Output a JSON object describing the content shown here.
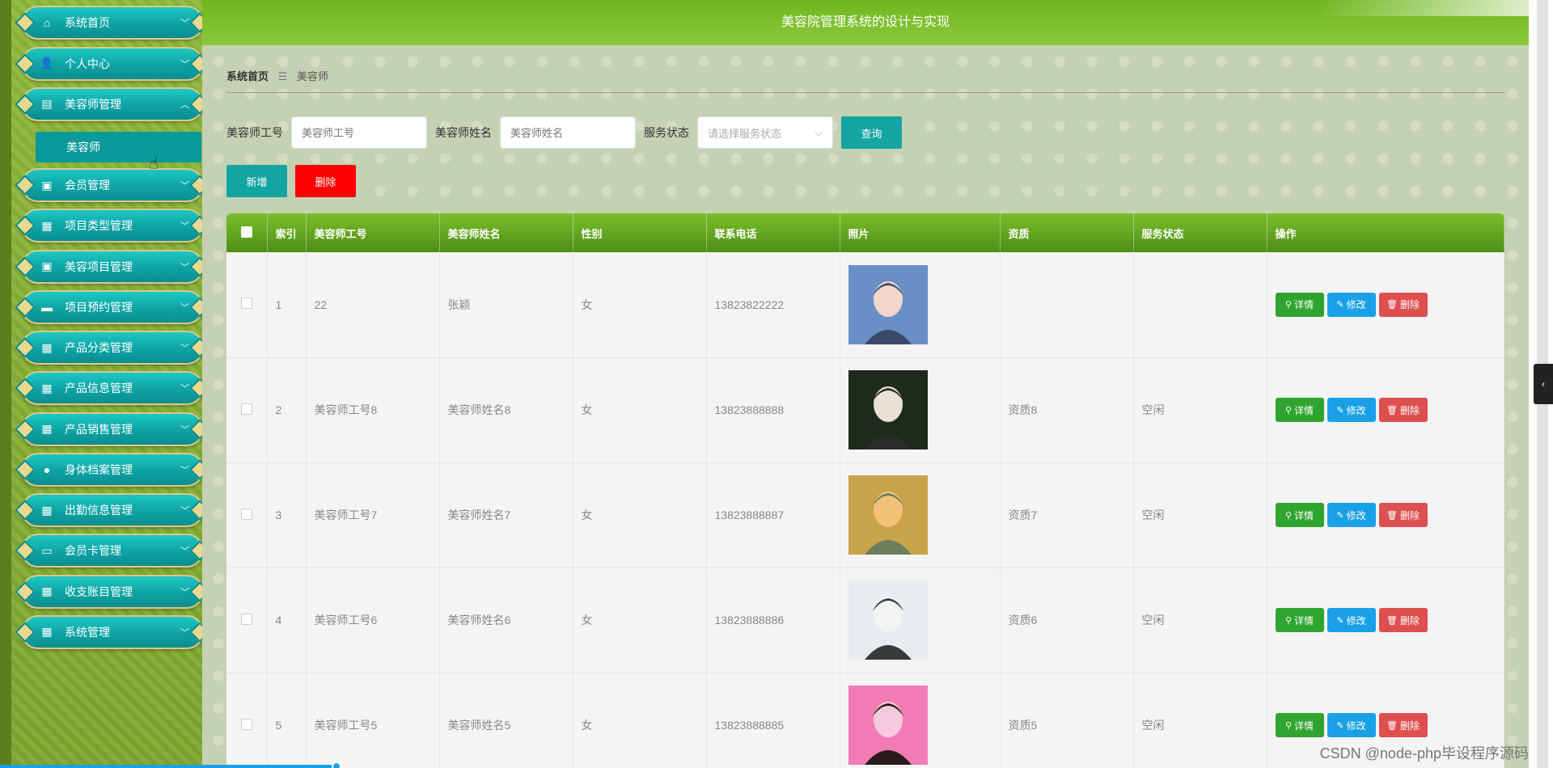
{
  "app": {
    "title": "美容院管理系统的设计与实现"
  },
  "sidebar": {
    "items": [
      {
        "label": "系统首页",
        "icon": "home-icon"
      },
      {
        "label": "个人中心",
        "icon": "user-icon"
      },
      {
        "label": "美容师管理",
        "icon": "chart-icon",
        "expanded": true
      },
      {
        "label": "会员管理",
        "icon": "clipboard-icon"
      },
      {
        "label": "项目类型管理",
        "icon": "grid-icon"
      },
      {
        "label": "美容项目管理",
        "icon": "clipboard-icon"
      },
      {
        "label": "项目预约管理",
        "icon": "chat-icon"
      },
      {
        "label": "产品分类管理",
        "icon": "grid-icon"
      },
      {
        "label": "产品信息管理",
        "icon": "grid-icon"
      },
      {
        "label": "产品销售管理",
        "icon": "grid-icon"
      },
      {
        "label": "身体档案管理",
        "icon": "bulb-icon"
      },
      {
        "label": "出勤信息管理",
        "icon": "grid-icon"
      },
      {
        "label": "会员卡管理",
        "icon": "card-icon"
      },
      {
        "label": "收支账目管理",
        "icon": "table-icon"
      },
      {
        "label": "系统管理",
        "icon": "grid-icon"
      }
    ],
    "submenu": {
      "label": "美容师"
    }
  },
  "breadcrumb": {
    "home": "系统首页",
    "separator": "☰",
    "current": "美容师"
  },
  "search": {
    "id_label": "美容师工号",
    "id_placeholder": "美容师工号",
    "name_label": "美容师姓名",
    "name_placeholder": "美容师姓名",
    "status_label": "服务状态",
    "status_placeholder": "请选择服务状态",
    "query_button": "查询"
  },
  "actions": {
    "add": "新增",
    "delete": "删除"
  },
  "table": {
    "headers": [
      "索引",
      "美容师工号",
      "美容师姓名",
      "性别",
      "联系电话",
      "照片",
      "资质",
      "服务状态",
      "操作"
    ],
    "rows": [
      {
        "index": "1",
        "id": "22",
        "name": "张颖",
        "gender": "女",
        "phone": "13823822222",
        "qualification": "",
        "status": ""
      },
      {
        "index": "2",
        "id": "美容师工号8",
        "name": "美容师姓名8",
        "gender": "女",
        "phone": "13823888888",
        "qualification": "资质8",
        "status": "空闲"
      },
      {
        "index": "3",
        "id": "美容师工号7",
        "name": "美容师姓名7",
        "gender": "女",
        "phone": "13823888887",
        "qualification": "资质7",
        "status": "空闲"
      },
      {
        "index": "4",
        "id": "美容师工号6",
        "name": "美容师姓名6",
        "gender": "女",
        "phone": "13823888886",
        "qualification": "资质6",
        "status": "空闲"
      },
      {
        "index": "5",
        "id": "美容师工号5",
        "name": "美容师姓名5",
        "gender": "女",
        "phone": "13823888885",
        "qualification": "资质5",
        "status": "空闲"
      }
    ],
    "op_labels": {
      "detail": "详情",
      "edit": "修改",
      "delete": "删除"
    }
  },
  "watermark": "CSDN @node-php毕设程序源码",
  "colors": {
    "header": "#7cbf2a",
    "teal": "#12a5a2",
    "danger": "#ff0000",
    "detail": "#2fa52f",
    "edit": "#1aa0e6",
    "delete": "#de4f4f"
  }
}
